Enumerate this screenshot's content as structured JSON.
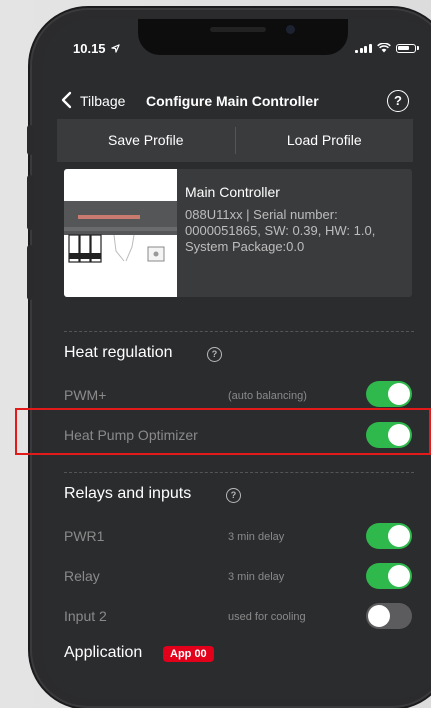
{
  "status": {
    "time": "10.15"
  },
  "nav": {
    "back_label": "Tilbage",
    "title": "Configure Main Controller"
  },
  "profile": {
    "save_label": "Save Profile",
    "load_label": "Load Profile"
  },
  "device": {
    "name": "Main Controller",
    "info": "088U11xx | Serial number: 0000051865, SW: 0.39, HW: 1.0, System Package:0.0"
  },
  "heat_regulation": {
    "title": "Heat regulation",
    "rows": [
      {
        "label": "PWM+",
        "desc": "(auto balancing)",
        "state": "on"
      },
      {
        "label": "Heat Pump Optimizer",
        "desc": "",
        "state": "on"
      }
    ]
  },
  "relays": {
    "title": "Relays and inputs",
    "rows": [
      {
        "label": "PWR1",
        "desc": "3 min delay",
        "state": "on"
      },
      {
        "label": "Relay",
        "desc": "3 min delay",
        "state": "on"
      },
      {
        "label": "Input 2",
        "desc": "used for cooling",
        "state": "off"
      }
    ]
  },
  "application": {
    "title": "Application",
    "badge": "App 00"
  },
  "colors": {
    "toggle_on": "#2fb84b",
    "toggle_off": "#5c5c5e",
    "badge_red": "#e3001b",
    "highlight": "#e21a1a"
  }
}
